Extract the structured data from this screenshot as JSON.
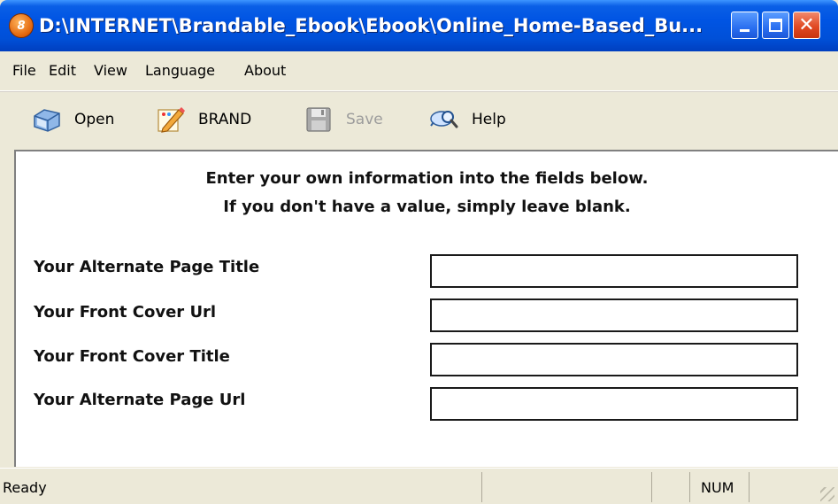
{
  "window": {
    "title": "D:\\INTERNET\\Brandable_Ebook\\Ebook\\Online_Home-Based_Bu...",
    "app_icon_text": "8",
    "title_bar_color": "#0054e3",
    "close_button_color": "#e14a24"
  },
  "menu": {
    "items": [
      "File",
      "Edit",
      "View",
      "Language",
      "About"
    ]
  },
  "toolbar": {
    "open_label": "Open",
    "open_icon": "open-folder-icon",
    "brand_label": "BRAND",
    "brand_icon": "brand-pencil-icon",
    "save_label": "Save",
    "save_icon": "floppy-disk-icon",
    "save_enabled": false,
    "help_label": "Help",
    "help_icon": "help-magnifier-icon"
  },
  "form": {
    "instruction_line1": "Enter your own information into the fields below.",
    "instruction_line2": "If you don't have a value, simply leave blank.",
    "fields": [
      {
        "label": "Your Alternate Page Title",
        "value": ""
      },
      {
        "label": "Your Front Cover Url",
        "value": ""
      },
      {
        "label": "Your Front Cover Title",
        "value": ""
      },
      {
        "label": "Your Alternate Page Url",
        "value": ""
      }
    ]
  },
  "statusbar": {
    "status_text": "Ready",
    "num_indicator": "NUM"
  }
}
